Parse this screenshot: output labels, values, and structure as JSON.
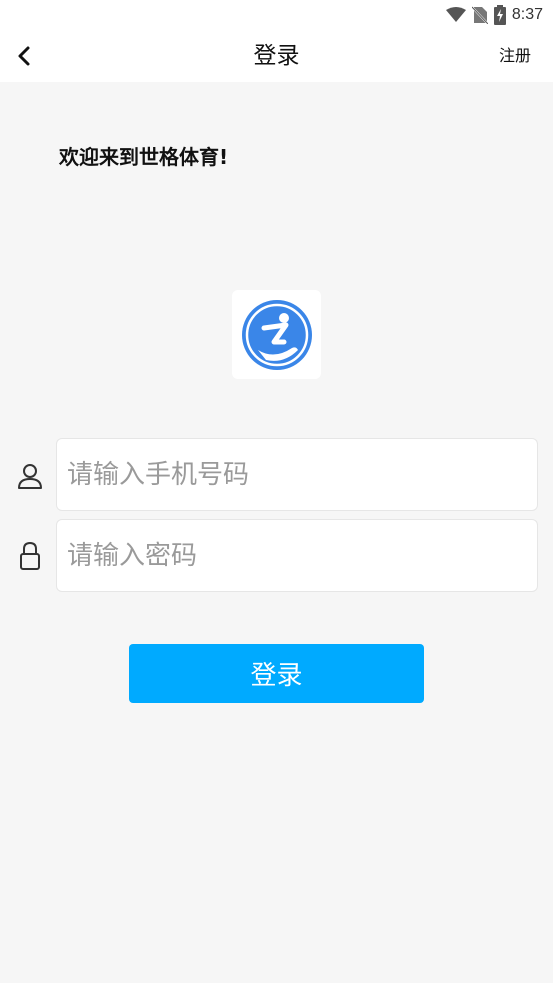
{
  "status_bar": {
    "time": "8:37",
    "icons": [
      "wifi-icon",
      "no-sim-icon",
      "battery-charging-icon"
    ]
  },
  "app_bar": {
    "back_icon": "chevron-left-icon",
    "title": "登录",
    "register_label": "注册"
  },
  "welcome_text": "欢迎来到世格体育!",
  "logo": {
    "icon": "app-logo-icon",
    "color": "#3a86e8"
  },
  "form": {
    "phone": {
      "icon": "person-icon",
      "placeholder": "请输入手机号码",
      "value": ""
    },
    "password": {
      "icon": "lock-icon",
      "placeholder": "请输入密码",
      "value": ""
    },
    "submit_label": "登录"
  },
  "colors": {
    "accent": "#00aaff",
    "background": "#f6f6f6",
    "surface": "#ffffff"
  }
}
